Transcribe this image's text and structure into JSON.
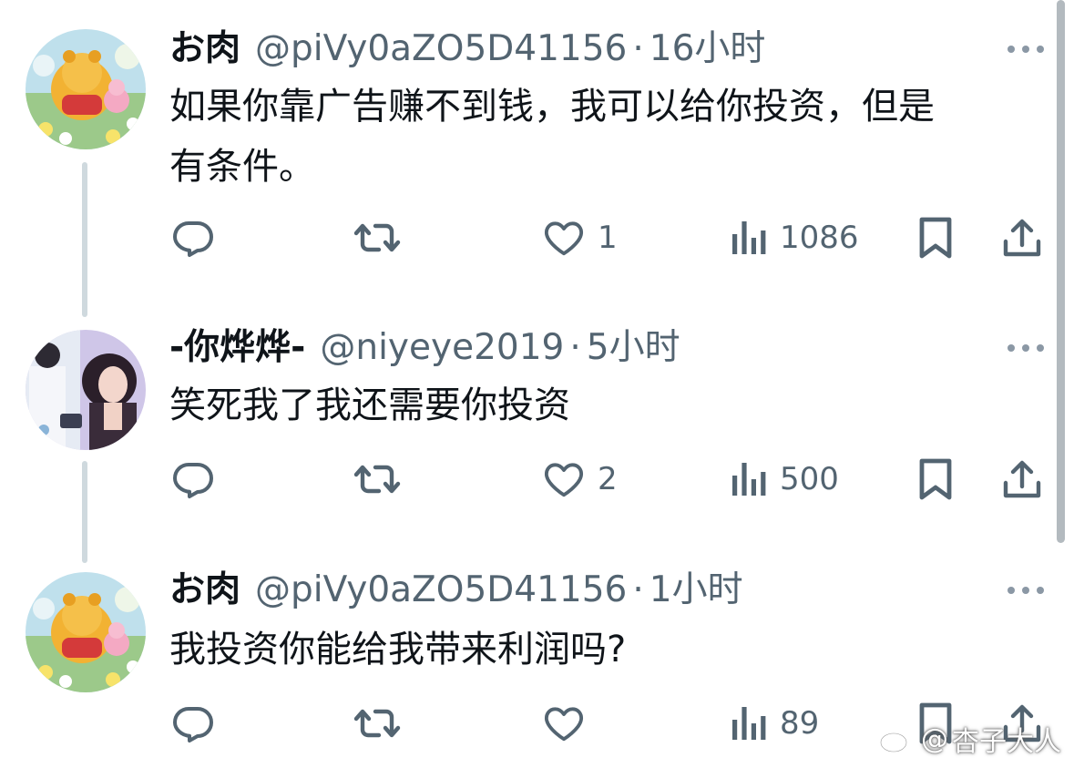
{
  "thread": {
    "tweets": [
      {
        "display_name": "お肉",
        "handle": "@piVy0aZO5D41156",
        "separator": "·",
        "time": "16小时",
        "text": "如果你靠广告赚不到钱，我可以给你投资，但是\n有条件。",
        "likes": "1",
        "views": "1086",
        "avatar": "winnie-the-pooh-avatar"
      },
      {
        "display_name": "-你烨烨-",
        "handle": "@niyeye2019",
        "separator": "·",
        "time": "5小时",
        "text": "笑死我了我还需要你投资",
        "likes": "2",
        "views": "500",
        "avatar": "girl-photo-avatar"
      },
      {
        "display_name": "お肉",
        "handle": "@piVy0aZO5D41156",
        "separator": "·",
        "time": "1小时",
        "text": "我投资你能给我带来利润吗?",
        "likes": "",
        "views": "89",
        "avatar": "winnie-the-pooh-avatar"
      }
    ]
  },
  "watermark": {
    "at": "@",
    "name": "杏子大人",
    "icon": "weibo-logo-icon"
  },
  "colors": {
    "text_primary": "#0f1419",
    "text_secondary": "#536471",
    "thread_line": "#cfd9de",
    "background": "#ffffff"
  },
  "icons": {
    "reply": "reply-icon",
    "retweet": "retweet-icon",
    "like": "heart-icon",
    "views": "views-bar-chart-icon",
    "bookmark": "bookmark-icon",
    "share": "share-icon",
    "more": "more-dots-icon"
  }
}
